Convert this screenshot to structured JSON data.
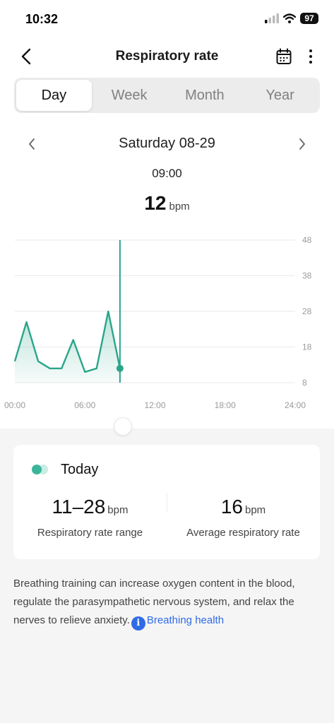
{
  "status_bar": {
    "time": "10:32",
    "battery": "97",
    "icons": [
      "signal-icon",
      "wifi-icon",
      "battery-icon"
    ]
  },
  "header": {
    "title": "Respiratory rate",
    "icons": [
      "back-icon",
      "calendar-icon",
      "more-icon"
    ]
  },
  "tabs": [
    {
      "label": "Day",
      "active": true
    },
    {
      "label": "Week",
      "active": false
    },
    {
      "label": "Month",
      "active": false
    },
    {
      "label": "Year",
      "active": false
    }
  ],
  "date_nav": {
    "date": "Saturday 08-29"
  },
  "selection": {
    "time": "09:00",
    "value": "12",
    "unit": "bpm"
  },
  "chart_data": {
    "type": "area",
    "x_ticks": [
      "00:00",
      "06:00",
      "12:00",
      "18:00",
      "24:00"
    ],
    "y_ticks": [
      "48",
      "38",
      "28",
      "18",
      "8"
    ],
    "ylim": [
      8,
      48
    ],
    "xlim": [
      0,
      24
    ],
    "grid": true,
    "y_axis_position": "right",
    "color": "#2aa58a",
    "x": [
      0,
      1,
      2,
      3,
      4,
      5,
      6,
      7,
      8,
      9
    ],
    "values": [
      14,
      25,
      14,
      12,
      12,
      20,
      11,
      12,
      28,
      12
    ],
    "selected_x": 9,
    "selected_value": 12
  },
  "summary": {
    "title": "Today",
    "range_value": "11–28",
    "range_unit": "bpm",
    "range_label": "Respiratory rate range",
    "avg_value": "16",
    "avg_unit": "bpm",
    "avg_label": "Average respiratory rate"
  },
  "description": {
    "text": "Breathing training can increase oxygen content in the blood, regulate the parasympathetic nervous system, and relax the nerves to relieve anxiety.",
    "info_glyph": "i",
    "link": "Breathing health"
  }
}
